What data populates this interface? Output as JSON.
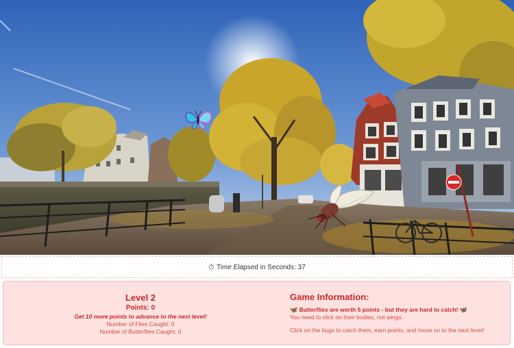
{
  "timer": {
    "icon": "stopwatch-icon",
    "label": "⏱",
    "text": "Time Elapsed in Seconds: 37"
  },
  "level": {
    "title": "Level 2",
    "points": "Points: 0",
    "advance": "Get 10 more points to advance to the next level!",
    "flies": "Number of Flies Caught: 0",
    "butterflies": "Number of Butterflies Caught: 0"
  },
  "info": {
    "title": "Game Information:",
    "butterfly_icon": "🦋",
    "butterfly_note": "Butterflies are worth 5 points - but they are hard to catch!",
    "wings_note": "You need to click on their bodies, not wings.",
    "instructions": "Click on the bugs to catch them, earn points, and move on to the next level!"
  },
  "scene": {
    "sign_icon": "no-entry-sign-icon"
  },
  "colors": {
    "accent": "#c62828",
    "panel_bg": "#fde2e0"
  }
}
